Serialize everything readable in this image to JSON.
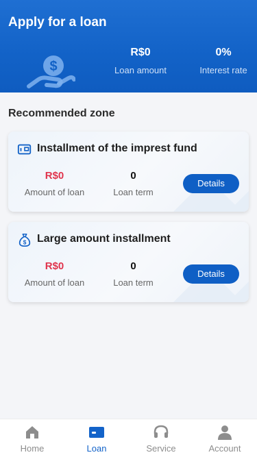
{
  "header": {
    "title": "Apply for a loan",
    "loan_amount_value": "R$0",
    "loan_amount_label": "Loan amount",
    "interest_rate_value": "0%",
    "interest_rate_label": "Interest rate",
    "hero_icon": "dollar-hand-icon"
  },
  "section": {
    "title": "Recommended zone"
  },
  "products": [
    {
      "icon": "card-icon",
      "title": "Installment of the imprest fund",
      "amount_value": "R$0",
      "amount_label": "Amount of loan",
      "term_value": "0",
      "term_label": "Loan term",
      "button_label": "Details"
    },
    {
      "icon": "money-bag-icon",
      "title": "Large amount installment",
      "amount_value": "R$0",
      "amount_label": "Amount of loan",
      "term_value": "0",
      "term_label": "Loan term",
      "button_label": "Details"
    }
  ],
  "tabbar": {
    "items": [
      {
        "label": "Home",
        "icon": "home-icon",
        "active": false
      },
      {
        "label": "Loan",
        "icon": "loan-icon",
        "active": true
      },
      {
        "label": "Service",
        "icon": "headset-icon",
        "active": false
      },
      {
        "label": "Account",
        "icon": "person-icon",
        "active": false
      }
    ]
  },
  "colors": {
    "primary": "#1262c7",
    "accent_red": "#e0344d",
    "active_tab": "#1363c9"
  }
}
